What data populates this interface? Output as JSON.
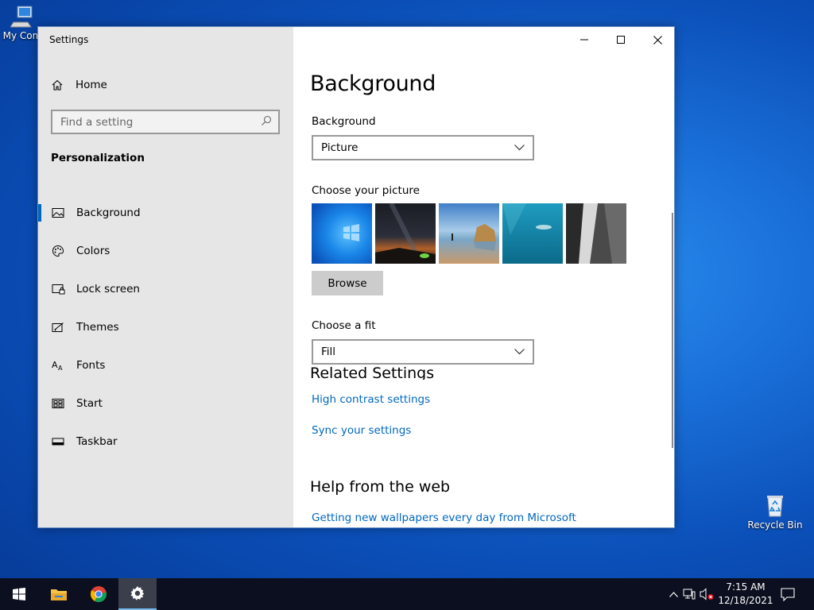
{
  "desktop": {
    "my_computer_label": "My Com",
    "recycle_bin_label": "Recycle Bin"
  },
  "window": {
    "title": "Settings",
    "controls": {
      "minimize": "minimize-icon",
      "maximize": "maximize-icon",
      "close": "close-icon"
    }
  },
  "sidebar": {
    "home_label": "Home",
    "search_placeholder": "Find a setting",
    "section_title": "Personalization",
    "items": [
      {
        "label": "Background",
        "icon": "picture-icon",
        "active": true
      },
      {
        "label": "Colors",
        "icon": "palette-icon",
        "active": false
      },
      {
        "label": "Lock screen",
        "icon": "lock-screen-icon",
        "active": false
      },
      {
        "label": "Themes",
        "icon": "themes-icon",
        "active": false
      },
      {
        "label": "Fonts",
        "icon": "fonts-icon",
        "active": false
      },
      {
        "label": "Start",
        "icon": "start-icon",
        "active": false
      },
      {
        "label": "Taskbar",
        "icon": "taskbar-icon",
        "active": false
      }
    ]
  },
  "main": {
    "title": "Background",
    "background_label": "Background",
    "background_value": "Picture",
    "choose_picture_label": "Choose your picture",
    "browse_label": "Browse",
    "choose_fit_label": "Choose a fit",
    "fit_value": "Fill",
    "related_title": "Related Settings",
    "links": {
      "high_contrast": "High contrast settings",
      "sync": "Sync your settings"
    },
    "help_title": "Help from the web",
    "help_link": "Getting new wallpapers every day from Microsoft"
  },
  "taskbar": {
    "time": "7:15 AM",
    "date": "12/18/2021"
  },
  "colors": {
    "accent": "#0067c0",
    "sidebar_bg": "#e6e6e6",
    "taskbar_bg": "#0b0f1f"
  }
}
